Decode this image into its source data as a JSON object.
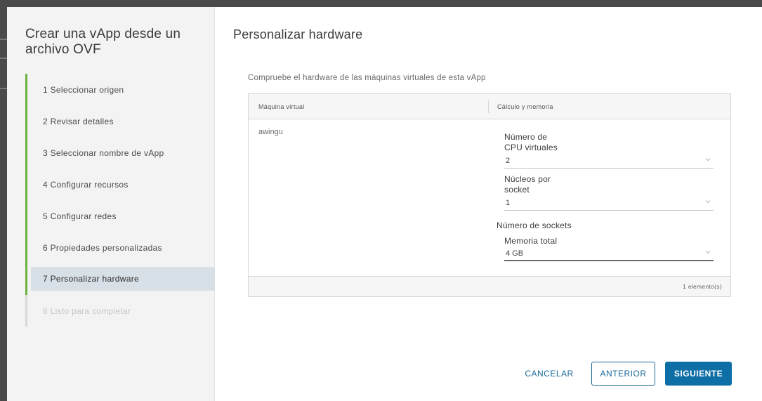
{
  "wizard": {
    "title": "Crear una vApp desde un archivo OVF",
    "steps": [
      {
        "label": "1  Seleccionar origen",
        "state": "complete"
      },
      {
        "label": "2  Revisar detalles",
        "state": "complete"
      },
      {
        "label": "3  Seleccionar nombre de vApp",
        "state": "complete"
      },
      {
        "label": "4  Configurar recursos",
        "state": "complete"
      },
      {
        "label": "5  Configurar redes",
        "state": "complete"
      },
      {
        "label": "6  Propiedades personalizadas",
        "state": "complete"
      },
      {
        "label": "7  Personalizar hardware",
        "state": "active"
      },
      {
        "label": "8  Listo para completar",
        "state": "disabled"
      }
    ]
  },
  "page": {
    "title": "Personalizar hardware",
    "subtitle": "Compruebe el hardware de las máquinas virtuales de esta vApp"
  },
  "grid": {
    "columns": [
      "Máquina virtual",
      "Cálculo y memoria"
    ],
    "row": {
      "vm_name": "awingu",
      "cpu_label_line1": "Número de",
      "cpu_label_line2": "CPU virtuales",
      "cpu_value": "2",
      "cores_label_line1": "Núcleos por",
      "cores_label_line2": "socket",
      "cores_value": "1",
      "sockets_label": "Número de sockets",
      "memory_label": "Memoria total",
      "memory_value": "4 GB"
    },
    "footer": "1 elemento(s)"
  },
  "buttons": {
    "cancel": "CANCELAR",
    "previous": "ANTERIOR",
    "next": "SIGUIENTE"
  },
  "colors": {
    "accent": "#0e6fa6",
    "step_complete": "#6db33f",
    "active_step_bg": "#d8e0e7"
  }
}
